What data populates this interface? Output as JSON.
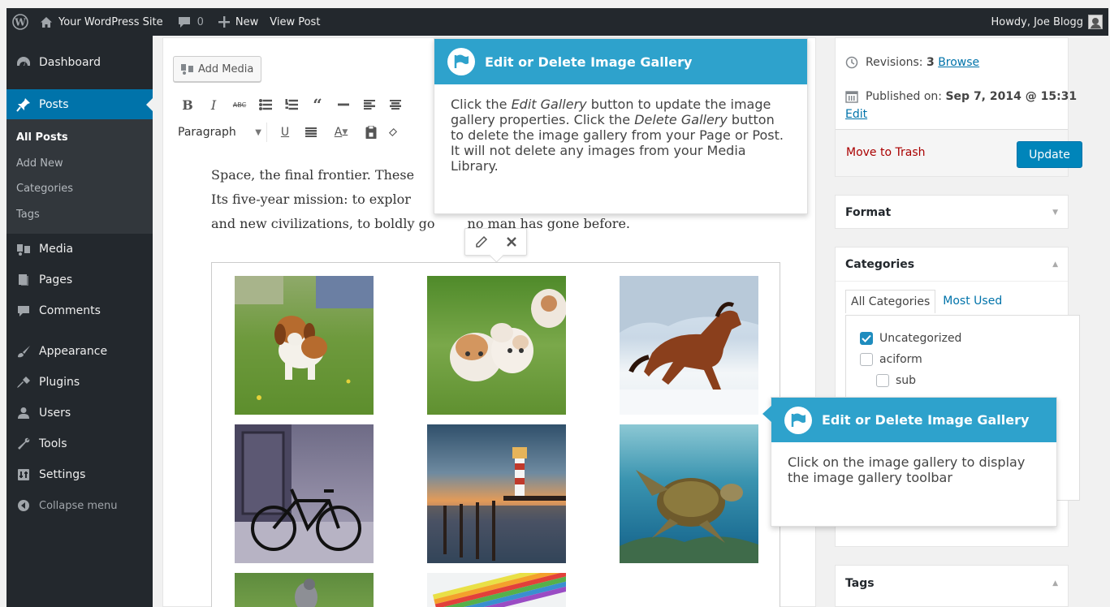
{
  "admin_bar": {
    "site_name": "Your WordPress Site",
    "comments_count": "0",
    "new_label": "New",
    "view_post_label": "View Post",
    "howdy": "Howdy, Joe Blogg"
  },
  "sidebar": {
    "items": [
      {
        "label": "Dashboard",
        "icon": "dashboard-icon"
      },
      {
        "label": "Posts",
        "icon": "pin-icon"
      },
      {
        "label": "Media",
        "icon": "media-icon"
      },
      {
        "label": "Pages",
        "icon": "pages-icon"
      },
      {
        "label": "Comments",
        "icon": "comments-icon"
      },
      {
        "label": "Appearance",
        "icon": "appearance-icon"
      },
      {
        "label": "Plugins",
        "icon": "plugins-icon"
      },
      {
        "label": "Users",
        "icon": "users-icon"
      },
      {
        "label": "Tools",
        "icon": "tools-icon"
      },
      {
        "label": "Settings",
        "icon": "settings-icon"
      }
    ],
    "posts_submenu": [
      "All Posts",
      "Add New",
      "Categories",
      "Tags"
    ],
    "collapse_label": "Collapse menu"
  },
  "editor": {
    "add_media_label": "Add Media",
    "format_select_value": "Paragraph",
    "content_lines": [
      "Space, the final frontier. These",
      "Its five-year mission: to explor",
      "and new civilizations, to boldly go"
    ],
    "content_tail": "no man has gone before."
  },
  "gallery": {
    "images": [
      "beagle puppy",
      "bulldog puppies",
      "horse in snow",
      "bicycle",
      "lighthouse",
      "sea turtle",
      "bird",
      "colored pencils"
    ]
  },
  "publish_box": {
    "revisions_label": "Revisions:",
    "revisions_count": "3",
    "browse_link": "Browse",
    "published_label": "Published on:",
    "published_date": "Sep 7, 2014 @ 15:31",
    "edit_link": "Edit",
    "trash_label": "Move to Trash",
    "update_label": "Update"
  },
  "format_box": {
    "title": "Format"
  },
  "categories_box": {
    "title": "Categories",
    "tab_all": "All Categories",
    "tab_most_used": "Most Used",
    "items": [
      {
        "label": "Uncategorized",
        "checked": true
      },
      {
        "label": "aciform",
        "checked": false
      },
      {
        "label": "sub",
        "checked": false
      }
    ]
  },
  "tags_box": {
    "title": "Tags"
  },
  "pointer_top": {
    "title": "Edit or Delete Image Gallery",
    "body_1": "Click the ",
    "body_em_1": "Edit Gallery",
    "body_2": " button to update the image gallery properties. Click the ",
    "body_em_2": "Delete Gallery",
    "body_3": " button to delete the image gallery from your Page or Post. It will not delete any images from your Media Library."
  },
  "pointer_right": {
    "title": "Edit or Delete Image Gallery",
    "body": "Click on the image gallery to display the image gallery toolbar"
  },
  "colors": {
    "admin_bar": "#23282d",
    "accent": "#0073aa",
    "pointer_header": "#2ea2cc",
    "trash_red": "#a00",
    "update_button": "#0085ba"
  }
}
